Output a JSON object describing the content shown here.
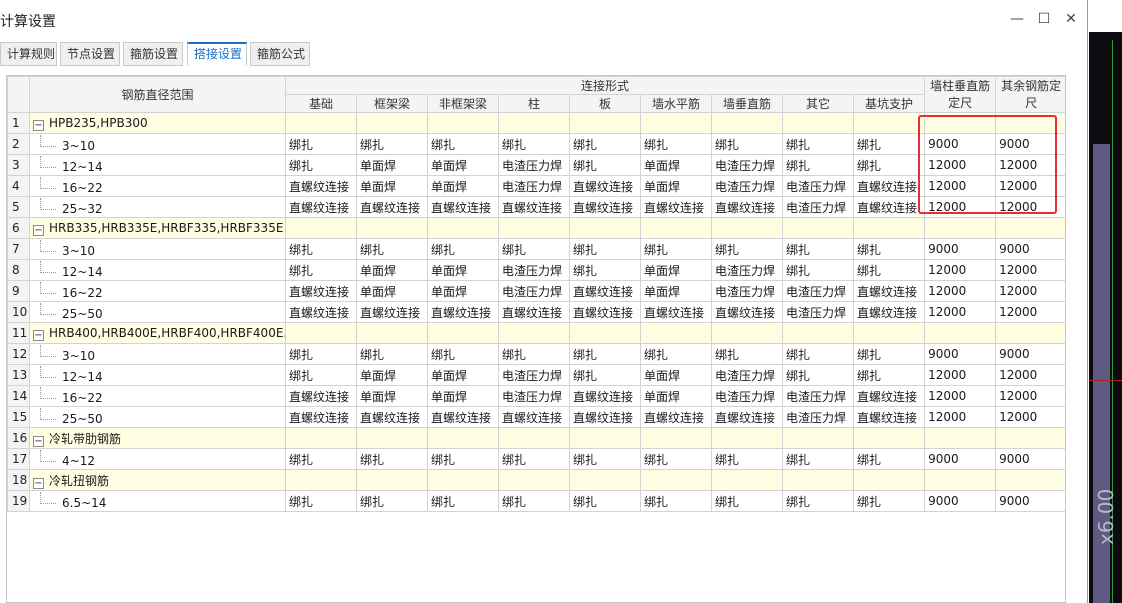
{
  "window": {
    "title": "计算设置",
    "minimize": "—",
    "maximize": "☐",
    "close": "✕"
  },
  "tabs": [
    "计算规则",
    "节点设置",
    "箍筋设置",
    "搭接设置",
    "箍筋公式"
  ],
  "active_tab": "搭接设置",
  "header": {
    "diameter_range": "钢筋直径范围",
    "connection_form": "连接形式",
    "cols": [
      "基础",
      "框架梁",
      "非框架梁",
      "柱",
      "板",
      "墙水平筋",
      "墙垂直筋",
      "其它",
      "基坑支护"
    ],
    "wall_col_length": "墙柱垂直筋定尺",
    "other_length": "其余钢筋定尺"
  },
  "rows": [
    {
      "n": "1",
      "group": true,
      "label": "HPB235,HPB300",
      "toggle": "−"
    },
    {
      "n": "2",
      "label": "3~10",
      "vals": [
        "绑扎",
        "绑扎",
        "绑扎",
        "绑扎",
        "绑扎",
        "绑扎",
        "绑扎",
        "绑扎",
        "绑扎",
        "9000",
        "9000"
      ]
    },
    {
      "n": "3",
      "label": "12~14",
      "vals": [
        "绑扎",
        "单面焊",
        "单面焊",
        "电渣压力焊",
        "绑扎",
        "单面焊",
        "电渣压力焊",
        "绑扎",
        "绑扎",
        "12000",
        "12000"
      ]
    },
    {
      "n": "4",
      "label": "16~22",
      "vals": [
        "直螺纹连接",
        "单面焊",
        "单面焊",
        "电渣压力焊",
        "直螺纹连接",
        "单面焊",
        "电渣压力焊",
        "电渣压力焊",
        "直螺纹连接",
        "12000",
        "12000"
      ]
    },
    {
      "n": "5",
      "label": "25~32",
      "vals": [
        "直螺纹连接",
        "直螺纹连接",
        "直螺纹连接",
        "直螺纹连接",
        "直螺纹连接",
        "直螺纹连接",
        "直螺纹连接",
        "电渣压力焊",
        "直螺纹连接",
        "12000",
        "12000"
      ]
    },
    {
      "n": "6",
      "group": true,
      "label": "HRB335,HRB335E,HRBF335,HRBF335E",
      "toggle": "−"
    },
    {
      "n": "7",
      "label": "3~10",
      "vals": [
        "绑扎",
        "绑扎",
        "绑扎",
        "绑扎",
        "绑扎",
        "绑扎",
        "绑扎",
        "绑扎",
        "绑扎",
        "9000",
        "9000"
      ]
    },
    {
      "n": "8",
      "label": "12~14",
      "vals": [
        "绑扎",
        "单面焊",
        "单面焊",
        "电渣压力焊",
        "绑扎",
        "单面焊",
        "电渣压力焊",
        "绑扎",
        "绑扎",
        "12000",
        "12000"
      ]
    },
    {
      "n": "9",
      "label": "16~22",
      "vals": [
        "直螺纹连接",
        "单面焊",
        "单面焊",
        "电渣压力焊",
        "直螺纹连接",
        "单面焊",
        "电渣压力焊",
        "电渣压力焊",
        "直螺纹连接",
        "12000",
        "12000"
      ]
    },
    {
      "n": "10",
      "label": "25~50",
      "vals": [
        "直螺纹连接",
        "直螺纹连接",
        "直螺纹连接",
        "直螺纹连接",
        "直螺纹连接",
        "直螺纹连接",
        "直螺纹连接",
        "电渣压力焊",
        "直螺纹连接",
        "12000",
        "12000"
      ]
    },
    {
      "n": "11",
      "group": true,
      "label": "HRB400,HRB400E,HRBF400,HRBF400E...",
      "toggle": "−"
    },
    {
      "n": "12",
      "label": "3~10",
      "vals": [
        "绑扎",
        "绑扎",
        "绑扎",
        "绑扎",
        "绑扎",
        "绑扎",
        "绑扎",
        "绑扎",
        "绑扎",
        "9000",
        "9000"
      ]
    },
    {
      "n": "13",
      "label": "12~14",
      "vals": [
        "绑扎",
        "单面焊",
        "单面焊",
        "电渣压力焊",
        "绑扎",
        "单面焊",
        "电渣压力焊",
        "绑扎",
        "绑扎",
        "12000",
        "12000"
      ]
    },
    {
      "n": "14",
      "label": "16~22",
      "vals": [
        "直螺纹连接",
        "单面焊",
        "单面焊",
        "电渣压力焊",
        "直螺纹连接",
        "单面焊",
        "电渣压力焊",
        "电渣压力焊",
        "直螺纹连接",
        "12000",
        "12000"
      ]
    },
    {
      "n": "15",
      "label": "25~50",
      "vals": [
        "直螺纹连接",
        "直螺纹连接",
        "直螺纹连接",
        "直螺纹连接",
        "直螺纹连接",
        "直螺纹连接",
        "直螺纹连接",
        "电渣压力焊",
        "直螺纹连接",
        "12000",
        "12000"
      ]
    },
    {
      "n": "16",
      "group": true,
      "label": "冷轧带肋钢筋",
      "toggle": "−"
    },
    {
      "n": "17",
      "label": "4~12",
      "vals": [
        "绑扎",
        "绑扎",
        "绑扎",
        "绑扎",
        "绑扎",
        "绑扎",
        "绑扎",
        "绑扎",
        "绑扎",
        "9000",
        "9000"
      ]
    },
    {
      "n": "18",
      "group": true,
      "label": "冷轧扭钢筋",
      "toggle": "−"
    },
    {
      "n": "19",
      "label": "6.5~14",
      "vals": [
        "绑扎",
        "绑扎",
        "绑扎",
        "绑扎",
        "绑扎",
        "绑扎",
        "绑扎",
        "绑扎",
        "绑扎",
        "9000",
        "9000"
      ]
    }
  ],
  "background_text": "x6.00",
  "colors": {
    "accent": "#1a6fc4",
    "highlight_box": "#e53030",
    "group_row_bg": "#fffee3"
  }
}
